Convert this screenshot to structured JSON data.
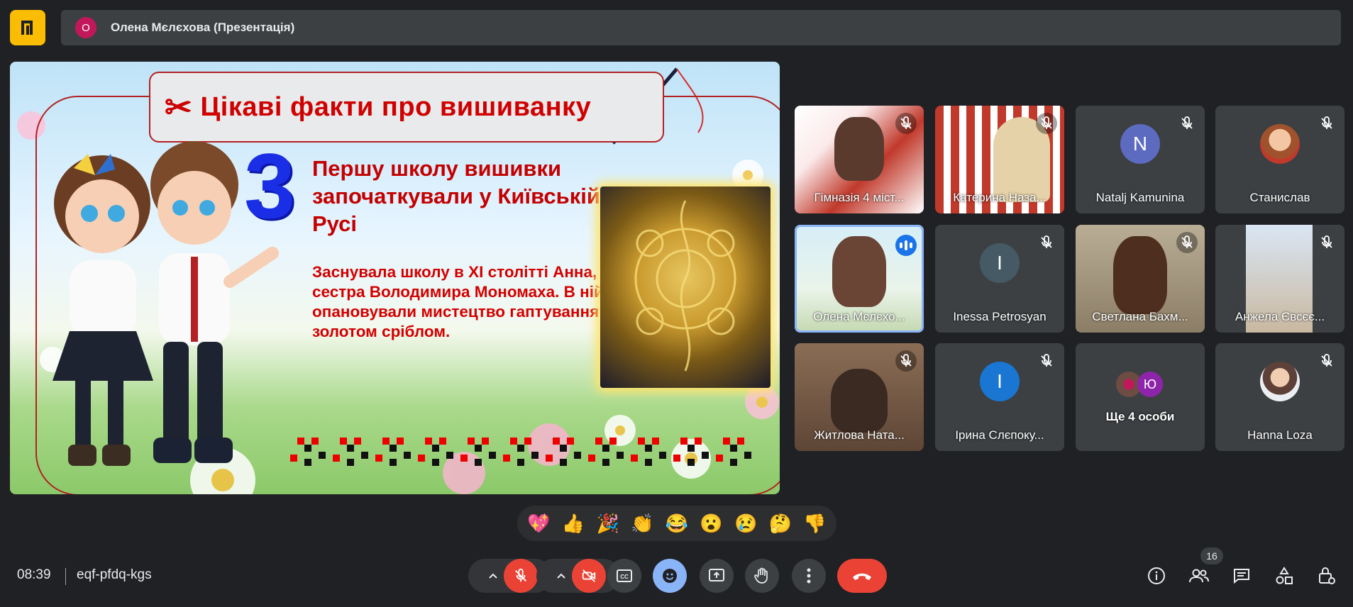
{
  "presenter": {
    "avatar_letter": "О",
    "label": "Олена Мєлєхова (Презентація)"
  },
  "slide": {
    "title": "Цікаві факти про вишиванку",
    "number": "3",
    "headline": "Першу школу вишивки започаткували у Київській Русі",
    "body": "Заснувала школу в XI столітті Анна, сестра Володимира Мономаха. В ній опановували мистецтво гаптування золотом сріблом."
  },
  "participants": [
    {
      "name": "Гімназія 4 міст...",
      "muted": true
    },
    {
      "name": "Катерина Наза...",
      "muted": true
    },
    {
      "name": "Natalj Kamunina",
      "letter": "N",
      "color": "#5c6bc0",
      "muted": true
    },
    {
      "name": "Станислав",
      "muted": true
    },
    {
      "name": "Олена Мєлєхо...",
      "speaking": true
    },
    {
      "name": "Inessa Petrosyan",
      "letter": "I",
      "color": "#455a64",
      "muted": true
    },
    {
      "name": "Светлана Бахм...",
      "muted": true
    },
    {
      "name": "Анжела Євсєє...",
      "muted": true
    },
    {
      "name": "Житлова Ната...",
      "muted": true
    },
    {
      "name": "Ірина Слєпоку...",
      "letter": "I",
      "color": "#1976d2",
      "muted": true
    },
    {
      "name": "Ще 4 особи",
      "letter": "Ю",
      "color": "#8e24aa"
    },
    {
      "name": "Hanna Loza",
      "muted": true
    }
  ],
  "reactions": [
    "💖",
    "👍",
    "🎉",
    "👏",
    "😂",
    "😮",
    "😢",
    "🤔",
    "👎"
  ],
  "meeting": {
    "time": "08:39",
    "code": "eqf-pfdq-kgs"
  },
  "people_count": "16",
  "icons": {
    "mic": "mic-off-icon",
    "camera": "camera-off-icon",
    "captions": "captions-icon",
    "emoji": "emoji-icon",
    "present": "present-icon",
    "hand": "raise-hand-icon",
    "more": "more-options-icon",
    "end": "end-call-icon",
    "info": "info-icon",
    "people": "people-icon",
    "chat": "chat-icon",
    "activities": "activities-icon",
    "host": "host-controls-icon"
  },
  "colors": {
    "background": "#202124",
    "surface": "#3c4043",
    "danger": "#ea4335",
    "accent": "#8ab4f8",
    "logo": "#fbbc04"
  }
}
